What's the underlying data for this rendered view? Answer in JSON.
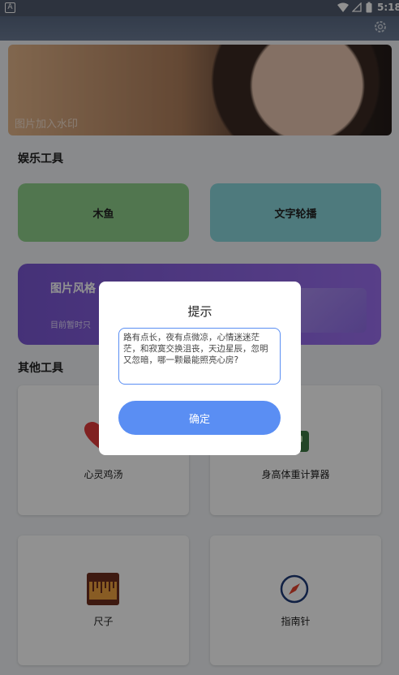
{
  "status_bar": {
    "time": "5:18",
    "left_icon": "a-icon",
    "wifi_icon": "wifi-icon",
    "battery_icon": "battery-icon"
  },
  "header": {
    "settings_icon": "gear-icon"
  },
  "banner": {
    "label": "图片加入水印"
  },
  "sections": {
    "entertainment": {
      "title": "娱乐工具",
      "cards": [
        {
          "label": "木鱼",
          "color": "#8fd08c"
        },
        {
          "label": "文字轮播",
          "color": "#8ad6dc"
        }
      ],
      "wide_card": {
        "label": "图片风格",
        "sub": "目前暂时只",
        "color": "#7a57d3"
      }
    },
    "other": {
      "title": "其他工具",
      "cards": [
        {
          "label": "心灵鸡汤",
          "icon": "heart-icon"
        },
        {
          "label": "身高体重计算器",
          "icon": "scale-icon"
        },
        {
          "label": "尺子",
          "icon": "ruler-icon"
        },
        {
          "label": "指南针",
          "icon": "compass-icon"
        }
      ]
    }
  },
  "dialog": {
    "title": "提示",
    "message": "路有点长，夜有点微凉，心情迷迷茫茫，和寂寞交换沮丧，天边星辰，忽明又忽暗，哪一颗最能照亮心房?",
    "confirm_label": "确定"
  }
}
